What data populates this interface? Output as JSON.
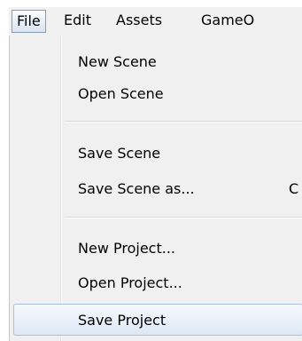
{
  "menubar": {
    "items": [
      {
        "label": "File"
      },
      {
        "label": "Edit"
      },
      {
        "label": "Assets"
      },
      {
        "label": "GameO"
      }
    ]
  },
  "file_menu": {
    "items": [
      {
        "label": "New Scene",
        "shortcut": ""
      },
      {
        "label": "Open Scene",
        "shortcut": ""
      },
      {
        "label": "Save Scene",
        "shortcut": ""
      },
      {
        "label": "Save Scene as...",
        "shortcut": "C"
      },
      {
        "label": "New Project...",
        "shortcut": ""
      },
      {
        "label": "Open Project...",
        "shortcut": ""
      },
      {
        "label": "Save Project",
        "shortcut": "",
        "highlighted": true
      }
    ]
  },
  "colors": {
    "menubar_bg": "#f1f1f1",
    "menu_bg": "#f0f0f0",
    "highlight_border": "#a9c1de",
    "active_border": "#8a9bb0"
  }
}
